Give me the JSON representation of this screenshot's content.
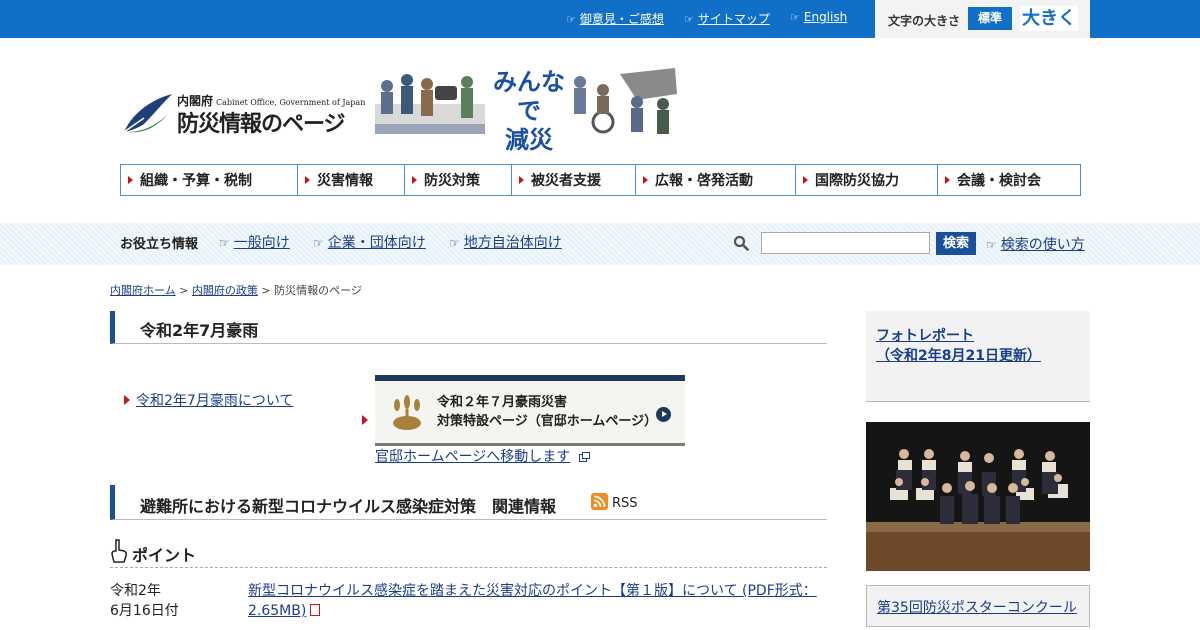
{
  "header": {
    "links": [
      {
        "label": "御意見・ご感想"
      },
      {
        "label": "サイトマップ"
      },
      {
        "label": "English"
      }
    ],
    "font_size": {
      "label": "文字の大きさ",
      "standard": "標準",
      "large": "大きく"
    }
  },
  "logo": {
    "org": "内閣府",
    "org_en": "Cabinet Office, Government of Japan",
    "title": "防災情報のページ",
    "slogan_line1": "みんなで",
    "slogan_line2": "減災"
  },
  "nav": {
    "items": [
      {
        "label": "組織・予算・税制"
      },
      {
        "label": "災害情報"
      },
      {
        "label": "防災対策"
      },
      {
        "label": "被災者支援"
      },
      {
        "label": "広報・啓発活動"
      },
      {
        "label": "国際防災協力"
      },
      {
        "label": "会議・検討会"
      }
    ]
  },
  "helpful": {
    "title": "お役立ち情報",
    "links": [
      {
        "label": "一般向け"
      },
      {
        "label": "企業・団体向け"
      },
      {
        "label": "地方自治体向け"
      }
    ]
  },
  "search": {
    "placeholder": "",
    "button": "検索",
    "help": "検索の使い方"
  },
  "breadcrumb": {
    "items": [
      "内閣府ホーム",
      "内閣府の政策",
      "防災情報のページ"
    ],
    "separator": ">"
  },
  "section1": {
    "title": "令和2年7月豪雨",
    "link": "令和2年7月豪雨について",
    "banner_line1": "令和２年７月豪雨災害",
    "banner_line2": "対策特設ページ（官邸ホームページ）",
    "kantei_link": "官邸ホームページへ移動します"
  },
  "section2": {
    "title": "避難所における新型コロナウイルス感染症対策　関連情報",
    "rss": "RSS",
    "point_heading": "ポイント",
    "items": [
      {
        "date_line1": "令和2年",
        "date_line2": "6月16日付",
        "title": "新型コロナウイルス感染症を踏まえた災害対応のポイント【第１版】について (PDF形式：2.65MB)"
      }
    ]
  },
  "sidebar": {
    "photo_report_line1": "フォトレポート",
    "photo_report_line2": "（令和2年8月21日更新）",
    "poster_contest": "第35回防災ポスターコンクール"
  },
  "colors": {
    "header_blue": "#1070c8",
    "heading_bar": "#1a4f9c",
    "nav_marker": "#c0161c",
    "link": "#1a3e8c"
  }
}
